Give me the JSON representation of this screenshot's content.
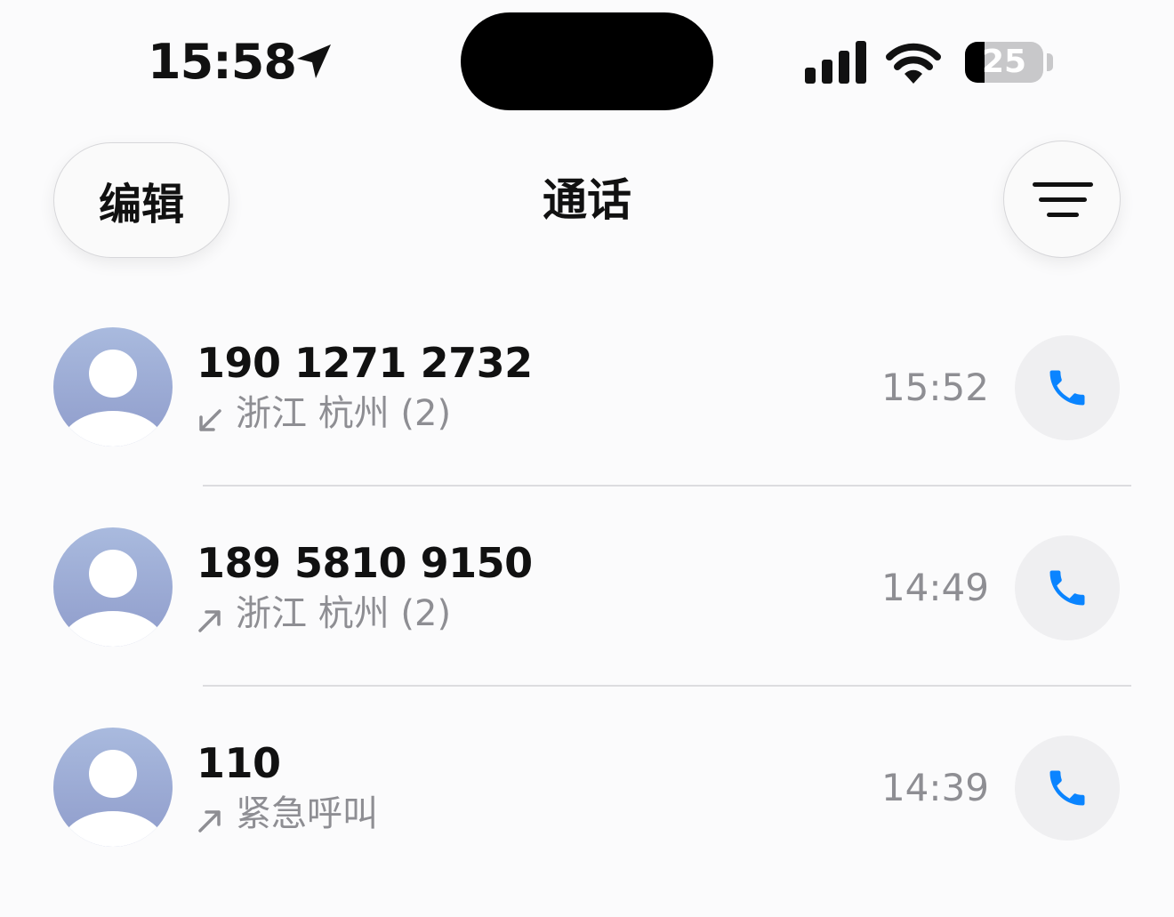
{
  "status_bar": {
    "time": "15:58",
    "battery": "25",
    "battery_level": 0.25,
    "icons": [
      "location-arrow-icon",
      "cellular-signal-icon",
      "wifi-icon",
      "battery-icon"
    ]
  },
  "nav": {
    "edit_label": "编辑",
    "title": "通话",
    "filter_icon": "filter-lines-icon"
  },
  "calls": [
    {
      "number": "190 1271 2732",
      "direction": "incoming",
      "direction_icon": "arrow-down-left-icon",
      "detail": "浙江 杭州 (2)",
      "time": "15:52"
    },
    {
      "number": "189 5810 9150",
      "direction": "outgoing",
      "direction_icon": "arrow-up-right-icon",
      "detail": "浙江 杭州 (2)",
      "time": "14:49"
    },
    {
      "number": "110",
      "direction": "outgoing",
      "direction_icon": "arrow-up-right-icon",
      "detail": "紧急呼叫",
      "time": "14:39"
    }
  ],
  "colors": {
    "accent": "#0a84ff",
    "secondary_text": "#8e8e93",
    "avatar_top": "#a9bade",
    "avatar_bottom": "#8f9ccb"
  }
}
